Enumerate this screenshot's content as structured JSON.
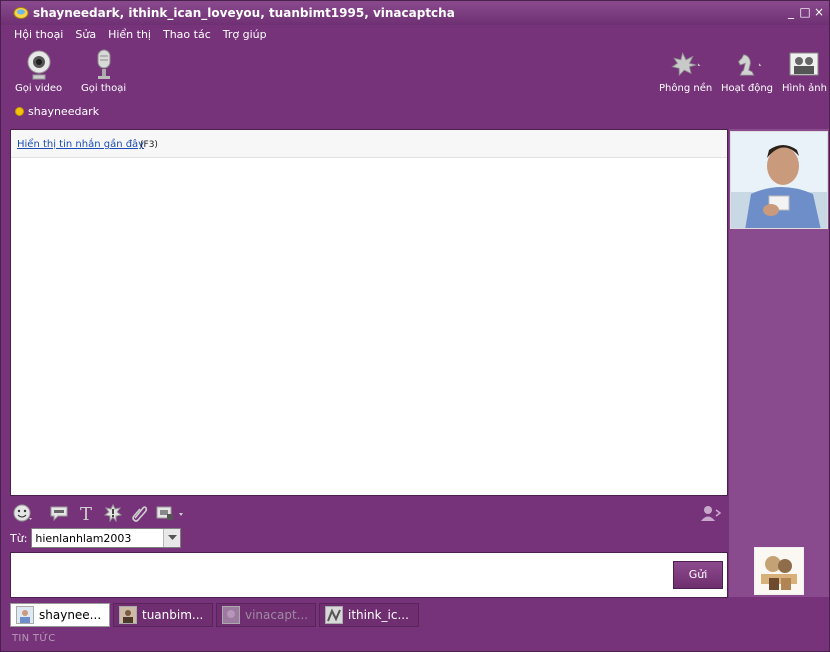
{
  "window": {
    "title": "shayneedark, ithink_ican_loveyou, tuanbimt1995, vinacaptcha",
    "controls": [
      "_",
      "□",
      "×"
    ]
  },
  "menu": {
    "items": [
      "Hội thoại",
      "Sửa",
      "Hiển thị",
      "Thao tác",
      "Trợ giúp"
    ]
  },
  "toolbar": {
    "video_call": "Gọi video",
    "voice_call": "Gọi thoại",
    "background": "Phông nền",
    "activities": "Hoạt động",
    "images": "Hình ảnh"
  },
  "status": {
    "user": "shayneedark",
    "color": "#f5c20a"
  },
  "chat": {
    "history_link": "Hiển thị tin nhắn gần đây",
    "history_key": "(F3)"
  },
  "compose": {
    "from_label": "Từ:",
    "from_value": "hienlanhlam2003",
    "send": "Gửi"
  },
  "tabs": [
    {
      "label": "shaynee...",
      "state": "active"
    },
    {
      "label": "tuanbim...",
      "state": "normal"
    },
    {
      "label": "vinacapt...",
      "state": "dim"
    },
    {
      "label": "ithink_ic...",
      "state": "normal"
    }
  ],
  "footer": {
    "news": "TIN TỨC"
  },
  "colors": {
    "window_bg": "#76337a",
    "link": "#1a4cb5",
    "status_online": "#f5c20a"
  }
}
